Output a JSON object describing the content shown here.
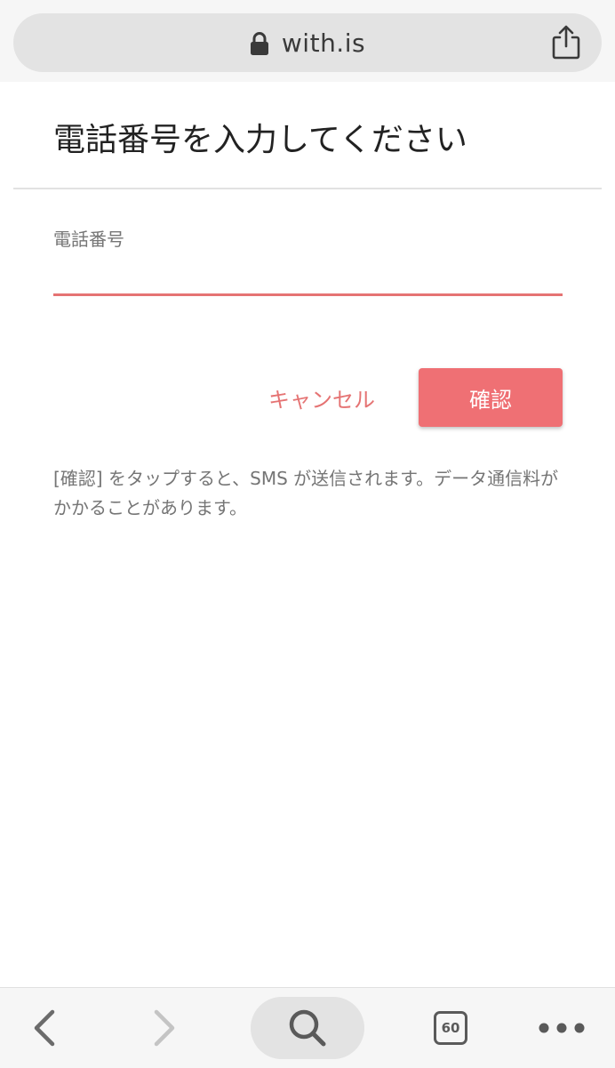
{
  "browser": {
    "url": "with.is",
    "tab_count": "60"
  },
  "dialog": {
    "title": "電話番号を入力してください",
    "phone_label": "電話番号",
    "phone_value": "",
    "cancel_label": "キャンセル",
    "confirm_label": "確認",
    "notice": "[確認] をタップすると、SMS が送信されます。データ通信料がかかることがあります。"
  },
  "colors": {
    "accent": "#ef7074",
    "accent_text": "#e57373",
    "bar_background": "#f6f6f6",
    "pill_background": "#e3e3e3"
  },
  "icons": {
    "lock": "lock-icon",
    "share": "share-icon",
    "back": "chevron-left-icon",
    "forward": "chevron-right-icon",
    "search": "search-icon",
    "tabs": "tabs-icon",
    "more": "more-dots-icon"
  }
}
